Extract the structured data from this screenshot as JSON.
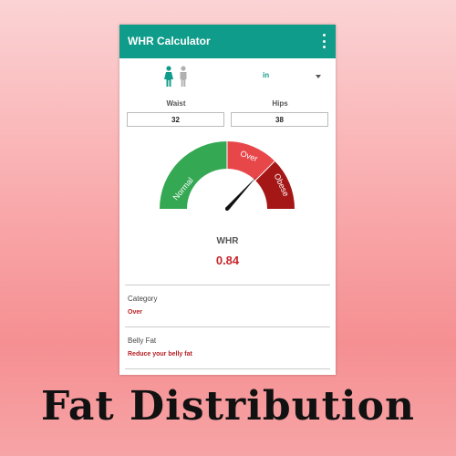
{
  "appbar": {
    "title": "WHR Calculator",
    "menu_icon": "kebab-menu-icon"
  },
  "gender": {
    "female_icon": "female-icon",
    "male_icon": "male-icon",
    "selected": "female"
  },
  "unit": {
    "value": "in"
  },
  "inputs": {
    "waist_label": "Waist",
    "waist_value": "32",
    "hips_label": "Hips",
    "hips_value": "38"
  },
  "gauge": {
    "segments": [
      {
        "label": "Normal",
        "color": "#34a853"
      },
      {
        "label": "Over",
        "color": "#e8474a"
      },
      {
        "label": "Obese",
        "color": "#a51616"
      }
    ]
  },
  "result": {
    "label": "WHR",
    "value": "0.84"
  },
  "details": {
    "category_title": "Category",
    "category_value": "Over",
    "belly_title": "Belly Fat",
    "belly_value": "Reduce your belly fat"
  },
  "caption": "Fat Distribution",
  "colors": {
    "primary": "#0f9c8a",
    "accent_red": "#c8262b"
  }
}
